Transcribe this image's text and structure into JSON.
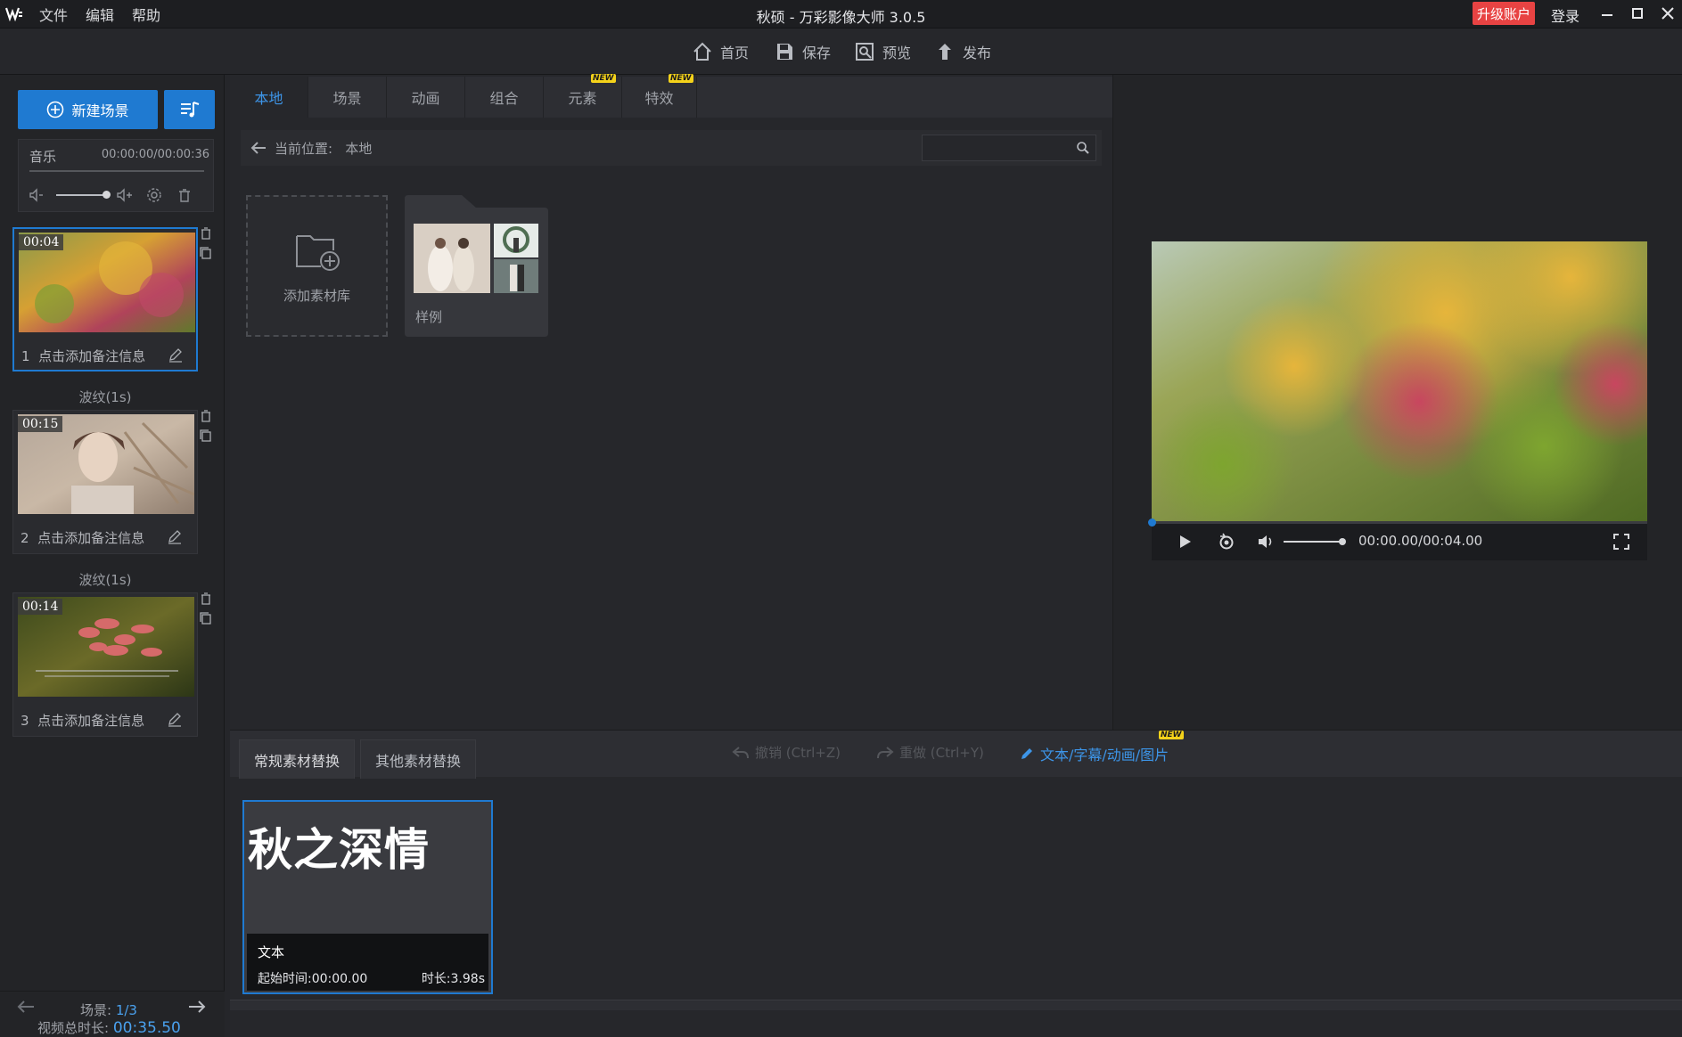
{
  "app": {
    "title": "秋硕 - 万彩影像大师 3.0.5",
    "logo": "W",
    "menu": [
      "文件",
      "编辑",
      "帮助"
    ],
    "upgrade_label": "升级账户",
    "login_label": "登录"
  },
  "toolbar": {
    "home": "首页",
    "save": "保存",
    "preview": "预览",
    "publish": "发布"
  },
  "left": {
    "new_scene": "新建场景",
    "music_label": "音乐",
    "music_time": "00:00:00/00:00:36",
    "scenes": [
      {
        "index": "1",
        "time": "00:04",
        "note": "点击添加备注信息"
      },
      {
        "index": "2",
        "time": "00:15",
        "note": "点击添加备注信息"
      },
      {
        "index": "3",
        "time": "00:14",
        "note": "点击添加备注信息"
      }
    ],
    "transitions": [
      "波纹(1s)",
      "波纹(1s)"
    ],
    "scene_counter_label": "场景: ",
    "scene_counter_value": "1/3",
    "total_label": "视频总时长: ",
    "total_value": "00:35.50"
  },
  "tabs": [
    {
      "label": "本地",
      "new": false
    },
    {
      "label": "场景",
      "new": false
    },
    {
      "label": "动画",
      "new": false
    },
    {
      "label": "组合",
      "new": false
    },
    {
      "label": "元素",
      "new": true
    },
    {
      "label": "特效",
      "new": true
    }
  ],
  "new_badge": "NEW",
  "location": {
    "label": "当前位置: ",
    "value": "本地",
    "search_placeholder": ""
  },
  "library": {
    "add_label": "添加素材库",
    "sample_label": "样例"
  },
  "player": {
    "time": "00:00.00/00:04.00",
    "progress": 0,
    "volume": 1.0
  },
  "bottom": {
    "tab_regular": "常规素材替换",
    "tab_other": "其他素材替换",
    "undo": "撤销 (Ctrl+Z)",
    "redo": "重做 (Ctrl+Y)",
    "edit_link": "文本/字幕/动画/图片",
    "card": {
      "text": "秋之深情",
      "type": "文本",
      "start": "起始时间:00:00.00",
      "duration": "时长:3.98s"
    }
  },
  "colors": {
    "accent": "#1f7ad1",
    "upgrade": "#e84343",
    "tab_active": "#3d95e8"
  }
}
